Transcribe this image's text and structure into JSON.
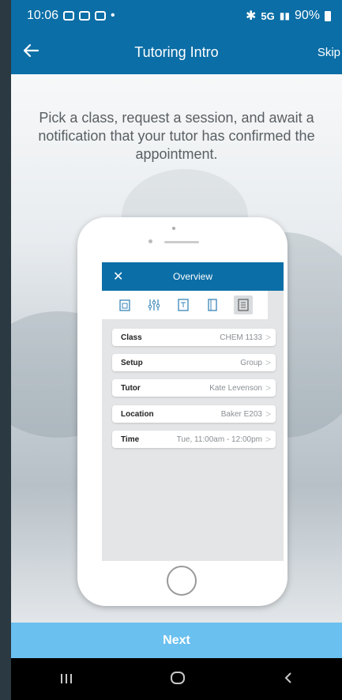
{
  "status": {
    "time": "10:06",
    "network": "5G",
    "battery": "90%"
  },
  "header": {
    "title": "Tutoring Intro",
    "skip": "Skip",
    "back_icon": "arrow-left-icon"
  },
  "intro_text": "Pick a class, request a session, and await a notification that your tutor has confirmed the appointment.",
  "mockup": {
    "overview_title": "Overview",
    "close_glyph": "✕",
    "tabs": [
      "calendar-icon",
      "sliders-icon",
      "document-icon",
      "notebook-icon",
      "list-icon"
    ],
    "rows": [
      {
        "label": "Class",
        "value": "CHEM 1133"
      },
      {
        "label": "Setup",
        "value": "Group"
      },
      {
        "label": "Tutor",
        "value": "Kate Levenson"
      },
      {
        "label": "Location",
        "value": "Baker E203"
      },
      {
        "label": "Time",
        "value": "Tue, 11:00am - 12:00pm"
      }
    ]
  },
  "next_label": "Next",
  "colors": {
    "primary": "#0b6ea6",
    "next_button": "#6ac0ef"
  }
}
